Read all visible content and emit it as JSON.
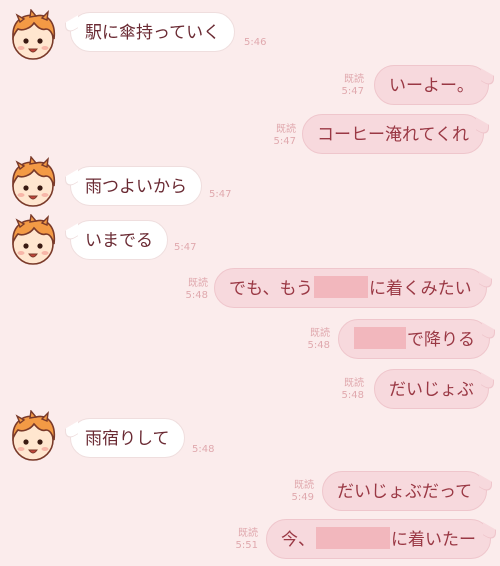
{
  "colors": {
    "background": "#fbecec",
    "incoming_bubble": "#ffffff",
    "outgoing_bubble": "#f7d9dd",
    "redaction": "#f2b7bd",
    "meta_text": "#e0a9ae"
  },
  "messages": [
    {
      "side": "in",
      "text": "駅に傘持っていく",
      "time": "5:46"
    },
    {
      "side": "out",
      "text": "いーよー。",
      "time": "5:47",
      "read": "既読"
    },
    {
      "side": "out",
      "text": "コーヒー淹れてくれ",
      "time": "5:47",
      "read": "既読"
    },
    {
      "side": "in",
      "text": "雨つよいから",
      "time": "5:47"
    },
    {
      "side": "in",
      "text": "いまでる",
      "time": "5:47"
    },
    {
      "side": "out",
      "text_before": "でも、もう",
      "text_after": "に着くみたい",
      "time": "5:48",
      "read": "既読"
    },
    {
      "side": "out",
      "text_before": "",
      "text_after": "で降りる",
      "time": "5:48",
      "read": "既読"
    },
    {
      "side": "out",
      "text": "だいじょぶ",
      "time": "5:48",
      "read": "既読"
    },
    {
      "side": "in",
      "text": "雨宿りして",
      "time": "5:48"
    },
    {
      "side": "out",
      "text": "だいじょぶだって",
      "time": "5:49",
      "read": "既読"
    },
    {
      "side": "out",
      "text_before": "今、",
      "text_after": "に着いたー",
      "time": "5:51",
      "read": "既読"
    }
  ]
}
